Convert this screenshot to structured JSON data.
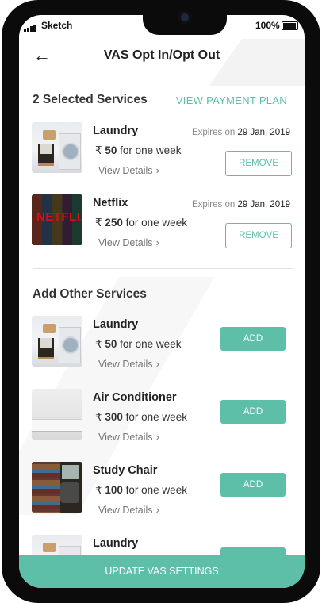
{
  "status_bar": {
    "carrier": "Sketch",
    "battery": "100%"
  },
  "header": {
    "title": "VAS Opt In/Opt Out"
  },
  "selected": {
    "heading": "2 Selected Services",
    "payment_link": "VIEW PAYMENT PLAN",
    "items": [
      {
        "name": "Laundry",
        "price": "50",
        "period": "for one week",
        "expires_label": "Expires on",
        "expires_date": "29 Jan, 2019",
        "details": "View Details",
        "action": "REMOVE"
      },
      {
        "name": "Netflix",
        "price": "250",
        "period": "for one week",
        "expires_label": "Expires on",
        "expires_date": "29 Jan, 2019",
        "details": "View Details",
        "action": "REMOVE"
      }
    ]
  },
  "other": {
    "heading": "Add Other Services",
    "items": [
      {
        "name": "Laundry",
        "price": "50",
        "period": "for one week",
        "details": "View Details",
        "action": "ADD"
      },
      {
        "name": "Air Conditioner",
        "price": "300",
        "period": "for one week",
        "details": "View Details",
        "action": "ADD"
      },
      {
        "name": "Study Chair",
        "price": "100",
        "period": "for one week",
        "details": "View Details",
        "action": "ADD"
      },
      {
        "name": "Laundry"
      }
    ]
  },
  "currency_symbol": "₹",
  "footer": {
    "button": "UPDATE VAS SETTINGS"
  },
  "colors": {
    "accent": "#5dbfa8"
  },
  "icons": {
    "back": "arrow-left-icon",
    "chevron": "chevron-right-icon"
  }
}
